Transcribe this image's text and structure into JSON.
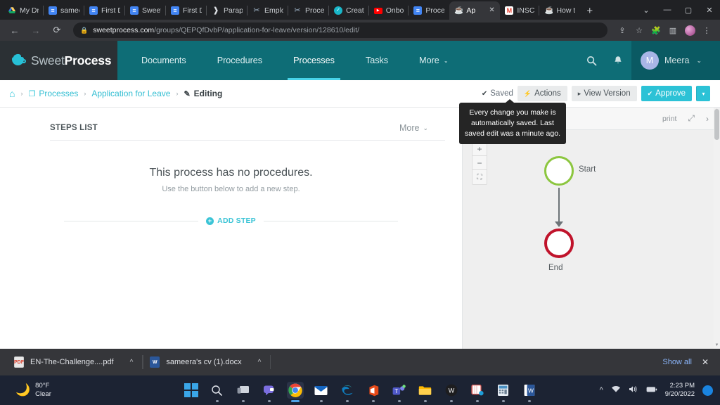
{
  "browser": {
    "tabs": [
      {
        "label": "My Dr",
        "icon": "drive-icon",
        "active": false
      },
      {
        "label": "samee",
        "icon": "docs-icon",
        "active": false
      },
      {
        "label": "First D",
        "icon": "docs-icon",
        "active": false
      },
      {
        "label": "Sweet",
        "icon": "docs-icon",
        "active": false
      },
      {
        "label": "First D",
        "icon": "docs-icon",
        "active": false
      },
      {
        "label": "Parap",
        "icon": "paraphrase-icon",
        "active": false
      },
      {
        "label": "Emplo",
        "icon": "scissors-icon",
        "active": false
      },
      {
        "label": "Proce",
        "icon": "scissors-icon",
        "active": false
      },
      {
        "label": "Creat",
        "icon": "check-circle-icon",
        "active": false
      },
      {
        "label": "Onbo",
        "icon": "youtube-icon",
        "active": false
      },
      {
        "label": "Proce",
        "icon": "docs-icon",
        "active": false
      },
      {
        "label": "Ap",
        "icon": "sweetprocess-icon",
        "active": true
      },
      {
        "label": "INSC",
        "icon": "gmail-icon",
        "active": false
      },
      {
        "label": "How t",
        "icon": "sweetprocess-icon",
        "active": false
      }
    ],
    "new_tab_label": "+",
    "window_controls": {
      "minimize": "—",
      "maximize": "▢",
      "close": "✕",
      "tab_search": "⌄"
    },
    "nav": {
      "back": "←",
      "forward": "→",
      "reload": "⟳"
    },
    "omnibox": {
      "lock_icon": "lock-icon",
      "host": "sweetprocess.com",
      "path": "/groups/QEPQfDvbP/application-for-leave/version/128610/edit/"
    },
    "toolbar_icons": [
      "share-icon",
      "bookmark-star-icon",
      "extensions-puzzle-icon",
      "side-panel-icon",
      "profile-avatar",
      "more-menu-icon"
    ]
  },
  "app": {
    "logo": {
      "prefix": "Sweet",
      "suffix": "Process",
      "icon": "coffee-cup-icon"
    },
    "nav_items": [
      {
        "label": "Documents",
        "active": false,
        "caret": false
      },
      {
        "label": "Procedures",
        "active": false,
        "caret": false
      },
      {
        "label": "Processes",
        "active": true,
        "caret": false
      },
      {
        "label": "Tasks",
        "active": false,
        "caret": false
      },
      {
        "label": "More",
        "active": false,
        "caret": true,
        "caret_glyph": "⌄"
      }
    ],
    "header_icons": [
      {
        "name": "search-icon",
        "glyph": "⌕"
      },
      {
        "name": "notification-bell-icon",
        "glyph": "🔔"
      }
    ],
    "user": {
      "initial": "M",
      "name": "Meera",
      "caret": "⌄"
    }
  },
  "breadcrumb": {
    "home_icon": "home-icon",
    "items": [
      {
        "label": "Processes",
        "icon": "documents-icon",
        "link": true
      },
      {
        "label": "Application for Leave",
        "icon": "",
        "link": true
      },
      {
        "label": "Editing",
        "icon": "pencil-icon",
        "link": false
      }
    ],
    "separator": "›"
  },
  "actions": {
    "saved_label": "Saved",
    "saved_icon": "check-icon",
    "buttons": [
      {
        "label": "Actions",
        "icon": "lightning-bolt-icon",
        "style": "gray"
      },
      {
        "label": "View Version",
        "icon": "play-triangle-icon",
        "style": "gray"
      },
      {
        "label": "Approve",
        "icon": "check-icon",
        "style": "primary"
      }
    ],
    "approve_caret": "▾"
  },
  "tooltip": {
    "text": "Every change you make is automatically saved. Last saved edit was a minute ago."
  },
  "steps": {
    "title": "STEPS LIST",
    "more_label": "More",
    "more_caret": "⌄",
    "empty_title": "This process has no procedures.",
    "empty_subtitle": "Use the button below to add a new step.",
    "add_label": "ADD STEP",
    "add_icon": "plus-circle-icon"
  },
  "flow": {
    "toolbar": [
      {
        "name": "print-link",
        "label": "print"
      },
      {
        "name": "expand-icon",
        "label": "⤢"
      },
      {
        "name": "collapse-panel-icon",
        "label": "›"
      }
    ],
    "zoom_controls": [
      {
        "name": "zoom-in-button",
        "label": "+"
      },
      {
        "name": "zoom-out-button",
        "label": "−"
      },
      {
        "name": "fit-screen-button",
        "label": "⛶"
      }
    ],
    "nodes": [
      {
        "name": "start-node",
        "label": "Start",
        "color": "#8cc63f"
      },
      {
        "name": "end-node",
        "label": "End",
        "color": "#c0132b"
      }
    ]
  },
  "downloads": {
    "items": [
      {
        "name": "EN-The-Challenge....pdf",
        "type": "pdf",
        "badge": "PDF",
        "caret": "^"
      },
      {
        "name": "sameera's cv (1).docx",
        "type": "docx",
        "badge": "W",
        "caret": "^"
      }
    ],
    "show_all": "Show all",
    "close": "✕"
  },
  "taskbar": {
    "weather": {
      "temp": "80°F",
      "condition": "Clear",
      "icon": "moon-icon"
    },
    "start_icon": "windows-start-icon",
    "apps": [
      {
        "name": "search-icon",
        "glyph": "⌕",
        "active": false
      },
      {
        "name": "task-view-icon",
        "glyph": "❐",
        "active": false
      },
      {
        "name": "chat-icon",
        "glyph": "💬",
        "active": false
      },
      {
        "name": "chrome-icon",
        "glyph": "",
        "active": true
      },
      {
        "name": "mail-icon",
        "glyph": "✉",
        "active": false
      },
      {
        "name": "edge-icon",
        "glyph": "",
        "active": false
      },
      {
        "name": "office-icon",
        "glyph": "",
        "active": false
      },
      {
        "name": "teams-icon",
        "glyph": "",
        "active": false
      },
      {
        "name": "file-explorer-icon",
        "glyph": "",
        "active": false
      },
      {
        "name": "wondershare-icon",
        "glyph": "W",
        "active": false
      },
      {
        "name": "snipping-tool-icon",
        "glyph": "",
        "active": false
      },
      {
        "name": "calculator-icon",
        "glyph": "",
        "active": false
      },
      {
        "name": "word-icon",
        "glyph": "W",
        "active": false
      }
    ],
    "tray": {
      "chevron": "^",
      "wifi": "wifi-icon",
      "volume": "volume-icon",
      "battery": "battery-icon",
      "time": "2:23 PM",
      "date": "9/20/2022",
      "notification_count": ""
    }
  }
}
